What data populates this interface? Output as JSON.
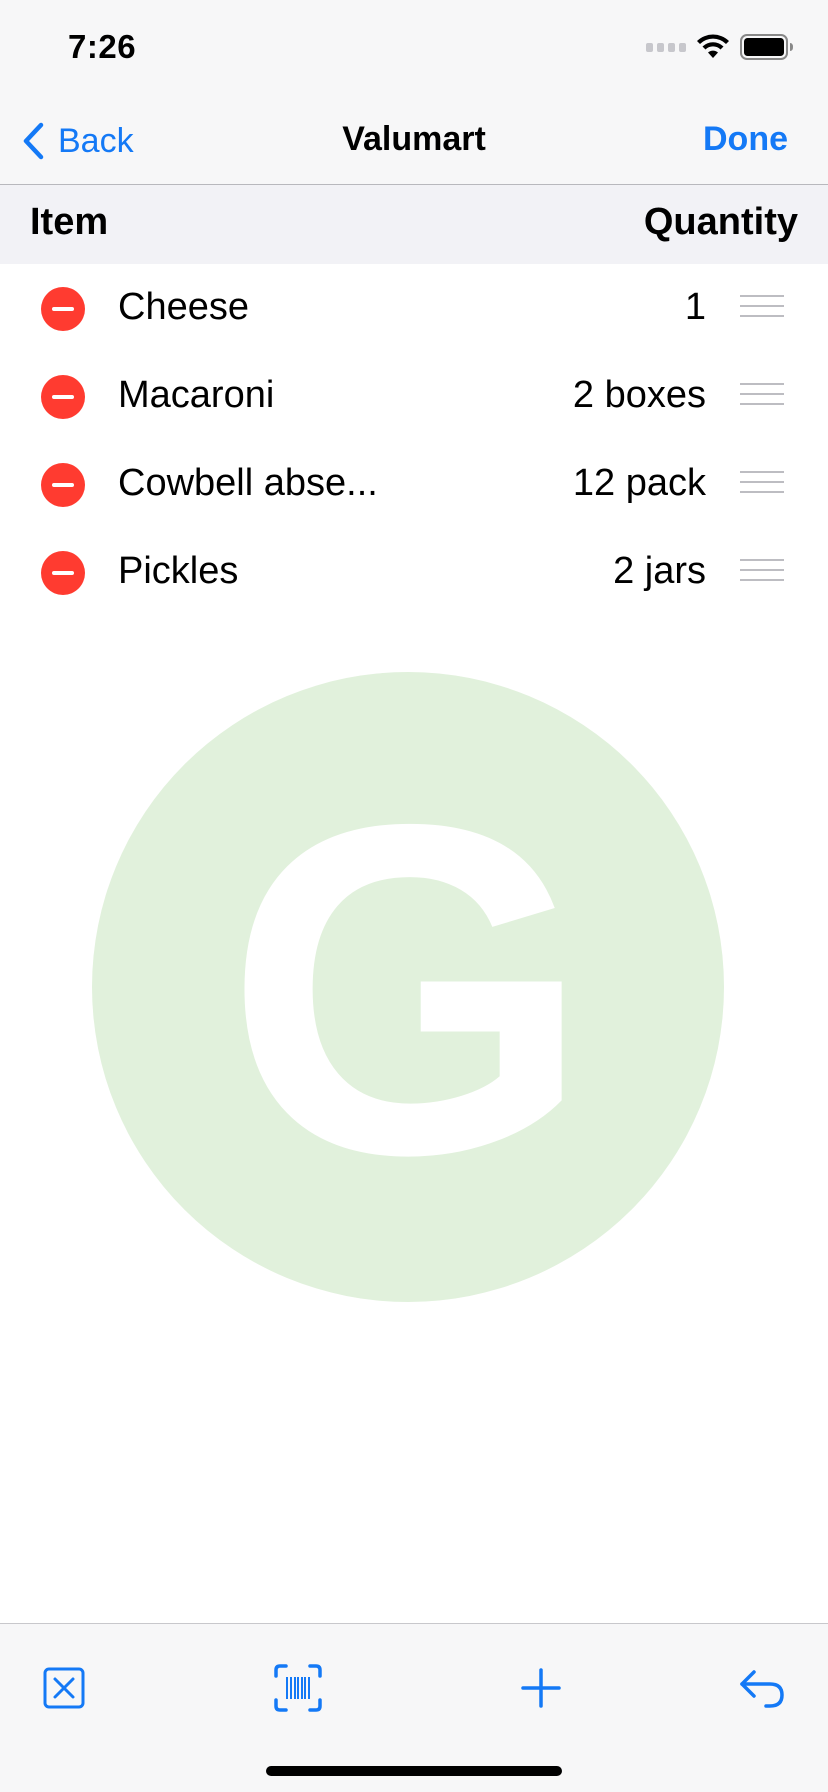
{
  "status_bar": {
    "time": "7:26",
    "icons": [
      "signal-icon",
      "wifi-icon",
      "battery-icon"
    ]
  },
  "nav": {
    "back_label": "Back",
    "title": "Valumart",
    "done_label": "Done"
  },
  "columns": {
    "item": "Item",
    "quantity": "Quantity"
  },
  "items": [
    {
      "name": "Cheese",
      "quantity": "1"
    },
    {
      "name": "Macaroni",
      "quantity": "2 boxes"
    },
    {
      "name": "Cowbell abse...",
      "quantity": "12 pack"
    },
    {
      "name": "Pickles",
      "quantity": "2 jars"
    }
  ],
  "logo": {
    "letter": "G"
  },
  "toolbar": {
    "icons": [
      "clear-list-icon",
      "barcode-scan-icon",
      "add-icon",
      "undo-icon"
    ]
  },
  "colors": {
    "accent": "#1479f6",
    "delete": "#ff3b30",
    "logo_background": "#e1f1dc"
  }
}
